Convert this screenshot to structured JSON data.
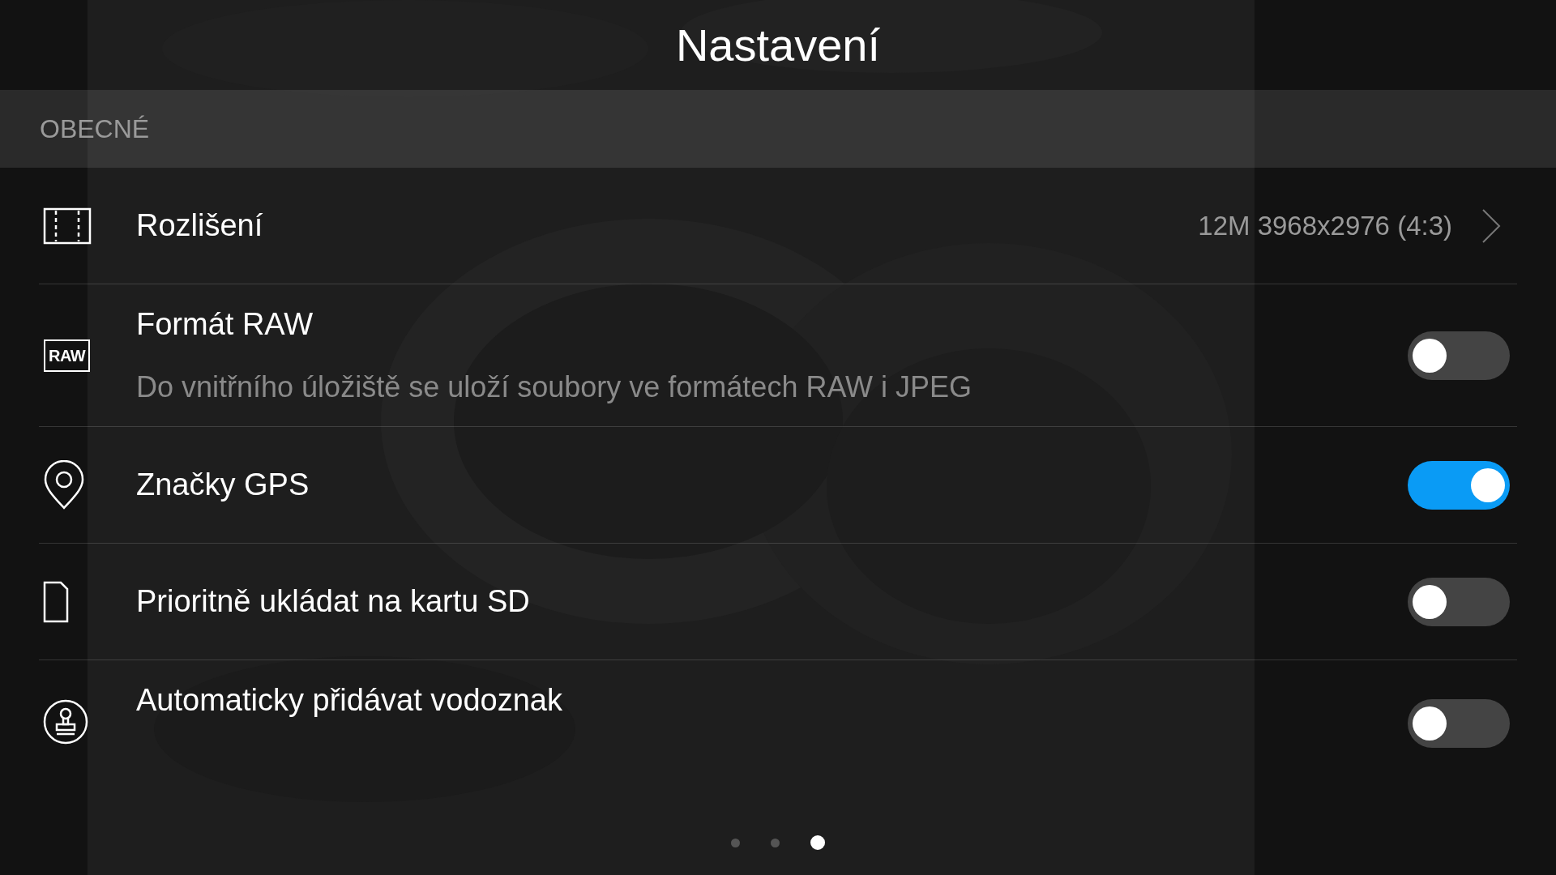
{
  "title": "Nastavení",
  "section": "OBECNÉ",
  "rows": [
    {
      "kind": "value",
      "label": "Rozlišení",
      "value": "12M 3968x2976 (4:3)"
    },
    {
      "kind": "toggle",
      "icon_text": "RAW",
      "label": "Formát RAW",
      "description": "Do vnitřního úložiště se uloží soubory ve formátech RAW i JPEG",
      "on": false
    },
    {
      "kind": "toggle",
      "label": "Značky GPS",
      "on": true
    },
    {
      "kind": "toggle",
      "label": "Prioritně ukládat na kartu SD",
      "on": false
    },
    {
      "kind": "toggle",
      "label": "Automaticky přidávat vodoznak",
      "on": false
    }
  ],
  "page_dots": [
    {
      "selected": false
    },
    {
      "selected": false
    },
    {
      "selected": true
    }
  ]
}
